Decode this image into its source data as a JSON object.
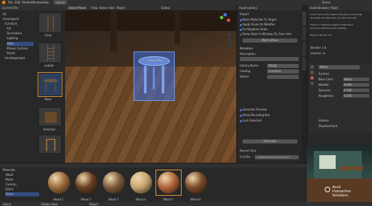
{
  "topbar": {
    "menus": [
      "File",
      "Edit",
      "Render",
      "Window",
      "Help"
    ],
    "active_tab": "Layout",
    "right_tab": "Scene"
  },
  "asset_browser_left": {
    "title": "Current File",
    "tree_items": [
      "All",
      "Unassigned",
      "Furniture",
      "Art",
      "Decoration",
      "Lighting",
      "Walls",
      "Pillows Curtains",
      "Plants",
      "Uncategorized"
    ],
    "thumbs": [
      "Chair",
      "Ladder",
      "Stool",
      "Armchair"
    ]
  },
  "viewport": {
    "mode": "Object Mode",
    "menus": [
      "View",
      "Select",
      "Add",
      "Object"
    ],
    "transform": "Global",
    "object_label": "Wooden Stool"
  },
  "addon_panel": {
    "title": "Asset Library",
    "section1": "Import",
    "options": [
      "Move Materials To Target",
      "Apply Scale On Modifier",
      "Fix Negative Scale",
      "Show Stats In Window Fly Over Info"
    ],
    "button1": "Mark Active",
    "section2": "Metadata",
    "fields": [
      {
        "label": "Description",
        "value": ""
      },
      {
        "label": "Library Name",
        "value": "Stools"
      },
      {
        "label": "Catalog",
        "value": "Furniture"
      },
      {
        "label": "Author",
        "value": ""
      }
    ],
    "checks": [
      "Generate Preview",
      "Show Bounding Box",
      "Lock Selected"
    ],
    "button2": "Generate",
    "section3": "Recent Files",
    "path_label": "Full File:",
    "path_value": "...local/assets/stool_library.blend"
  },
  "outliner_tabs": [
    "Tool",
    "View",
    "Item",
    "Edit"
  ],
  "right_sidebar": {
    "title": "Asset Browser: Read",
    "info_lines": [
      "Look to the vendor asset to the space and change",
      "the name and label when you add new asset",
      "",
      "There is a reference image of what set as",
      "done here with the scene available.",
      "",
      "Base for Blender 3.0"
    ],
    "version_label": "Blender 3.0",
    "license_label": "License: cc",
    "section": "Surface",
    "material_name": "Wood",
    "props": [
      {
        "label": "Base Color",
        "value": "Wood"
      },
      {
        "label": "Metallic",
        "value": "0.000"
      },
      {
        "label": "Specular",
        "value": "0.500"
      },
      {
        "label": "Roughness",
        "value": "0.500"
      }
    ],
    "sub_sections": [
      "Volume",
      "Displacement"
    ]
  },
  "preview": {
    "brand_line1": "Anvil",
    "brand_line2": "Interactive",
    "brand_line3": "Solutions"
  },
  "bottom_browser": {
    "tree_items": [
      "Materials",
      "Wood",
      "Metal",
      "Ceramic",
      "Fabric",
      "Stone"
    ],
    "materials": [
      "Wood 1",
      "Wood 2",
      "Wood 3",
      "Wood 4",
      "Wood 5",
      "Wood 6"
    ],
    "colors": [
      "#9a6a3a",
      "#6a4022",
      "#7a5a3a",
      "#c8a470",
      "#b0643a",
      "#7a4a28"
    ]
  },
  "statusbar": {
    "left": "Select",
    "middle": "Rotate View",
    "right": "Object"
  }
}
